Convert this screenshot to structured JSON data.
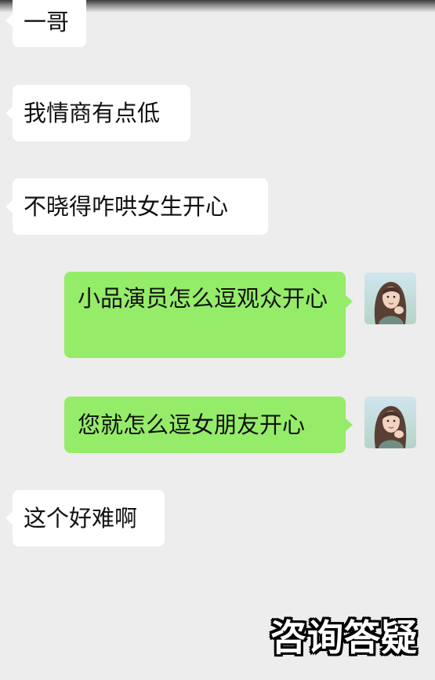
{
  "messages": [
    {
      "side": "left",
      "text": "一哥"
    },
    {
      "side": "left",
      "text": "我情商有点低"
    },
    {
      "side": "left",
      "text": "不晓得咋哄女生开心"
    },
    {
      "side": "right",
      "text": "小品演员怎么逗观众开心"
    },
    {
      "side": "right",
      "text": "您就怎么逗女朋友开心"
    },
    {
      "side": "left",
      "text": "这个好难啊"
    }
  ],
  "watermark": "咨询答疑",
  "colors": {
    "background": "#ededed",
    "bubble_left": "#ffffff",
    "bubble_right": "#95ec69"
  },
  "icons": {
    "avatar": "avatar-illustrated-woman"
  }
}
